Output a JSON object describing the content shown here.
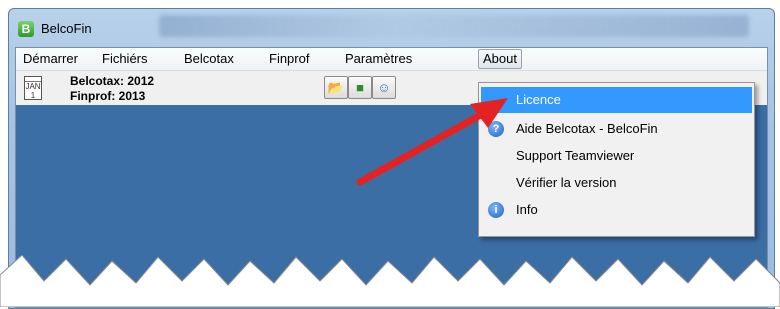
{
  "window": {
    "title": "BelcoFin",
    "app_icon": "belcofin-logo-icon"
  },
  "menubar": {
    "items": [
      {
        "label": "Démarrer"
      },
      {
        "label": "Fichiérs"
      },
      {
        "label": "Belcotax"
      },
      {
        "label": "Finprof"
      },
      {
        "label": "Paramètres"
      },
      {
        "label": "About"
      }
    ]
  },
  "toolbar": {
    "belcotax": "Belcotax: 2012",
    "finprof": "Finprof: 2013",
    "calendar_icon_text": "JAN 1",
    "buttons": [
      "folders-icon",
      "truck-icon",
      "users-icon"
    ]
  },
  "about_menu": {
    "items": [
      {
        "label": "Licence",
        "highlighted": true,
        "icon": ""
      },
      {
        "label": "Aide Belcotax - BelcoFin",
        "icon": "help-icon"
      },
      {
        "label": "Support Teamviewer",
        "icon": ""
      },
      {
        "label": "Vérifier la version",
        "icon": ""
      },
      {
        "label": "Info",
        "icon": "info-icon"
      }
    ]
  },
  "colors": {
    "workspace": "#3a6ea5",
    "highlight": "#3399ff",
    "arrow": "#e52222"
  }
}
